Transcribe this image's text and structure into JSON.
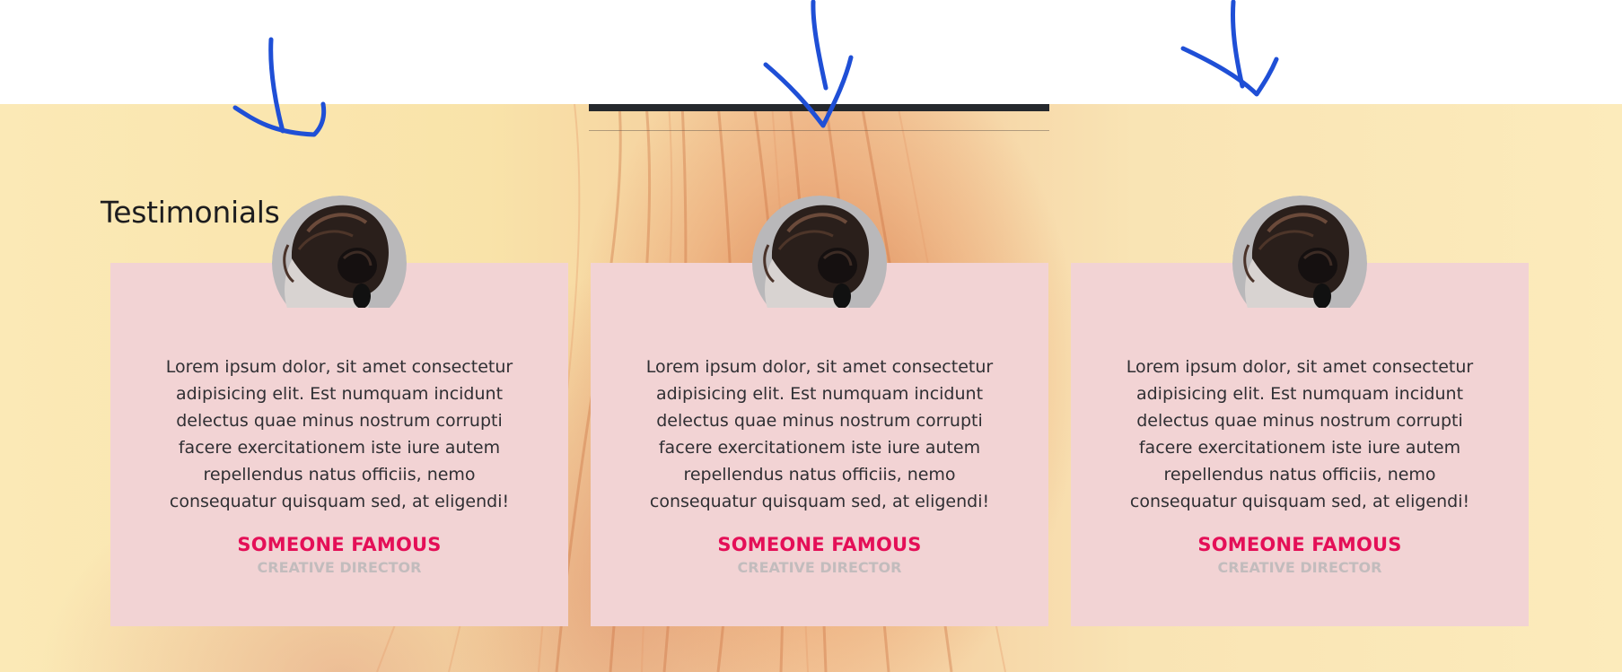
{
  "section": {
    "title": "Testimonials"
  },
  "testimonials": [
    {
      "quote": "Lorem ipsum dolor, sit amet consectetur adipisicing elit. Est numquam incidunt delectus quae minus nostrum corrupti facere exercitationem iste iure autem repellendus natus officiis, nemo consequatur quisquam sed, at eligendi!",
      "name": "SOMEONE FAMOUS",
      "role": "CREATIVE DIRECTOR",
      "avatar_icon": "woman-hair-bun-photo"
    },
    {
      "quote": "Lorem ipsum dolor, sit amet consectetur adipisicing elit. Est numquam incidunt delectus quae minus nostrum corrupti facere exercitationem iste iure autem repellendus natus officiis, nemo consequatur quisquam sed, at eligendi!",
      "name": "SOMEONE FAMOUS",
      "role": "CREATIVE DIRECTOR",
      "avatar_icon": "woman-hair-bun-photo"
    },
    {
      "quote": "Lorem ipsum dolor, sit amet consectetur adipisicing elit. Est numquam incidunt delectus quae minus nostrum corrupti facere exercitationem iste iure autem repellendus natus officiis, nemo consequatur quisquam sed, at eligendi!",
      "name": "SOMEONE FAMOUS",
      "role": "CREATIVE DIRECTOR",
      "avatar_icon": "woman-hair-bun-photo"
    }
  ],
  "colors": {
    "card_background": "#f2d3d4",
    "name_accent": "#e40f57",
    "role_text": "#c2bcbd",
    "annotation_ink": "#1f4fd6",
    "nav_bar": "#25282d"
  },
  "annotations": {
    "icon": "hand-drawn-arrow-icon",
    "count": 3
  }
}
